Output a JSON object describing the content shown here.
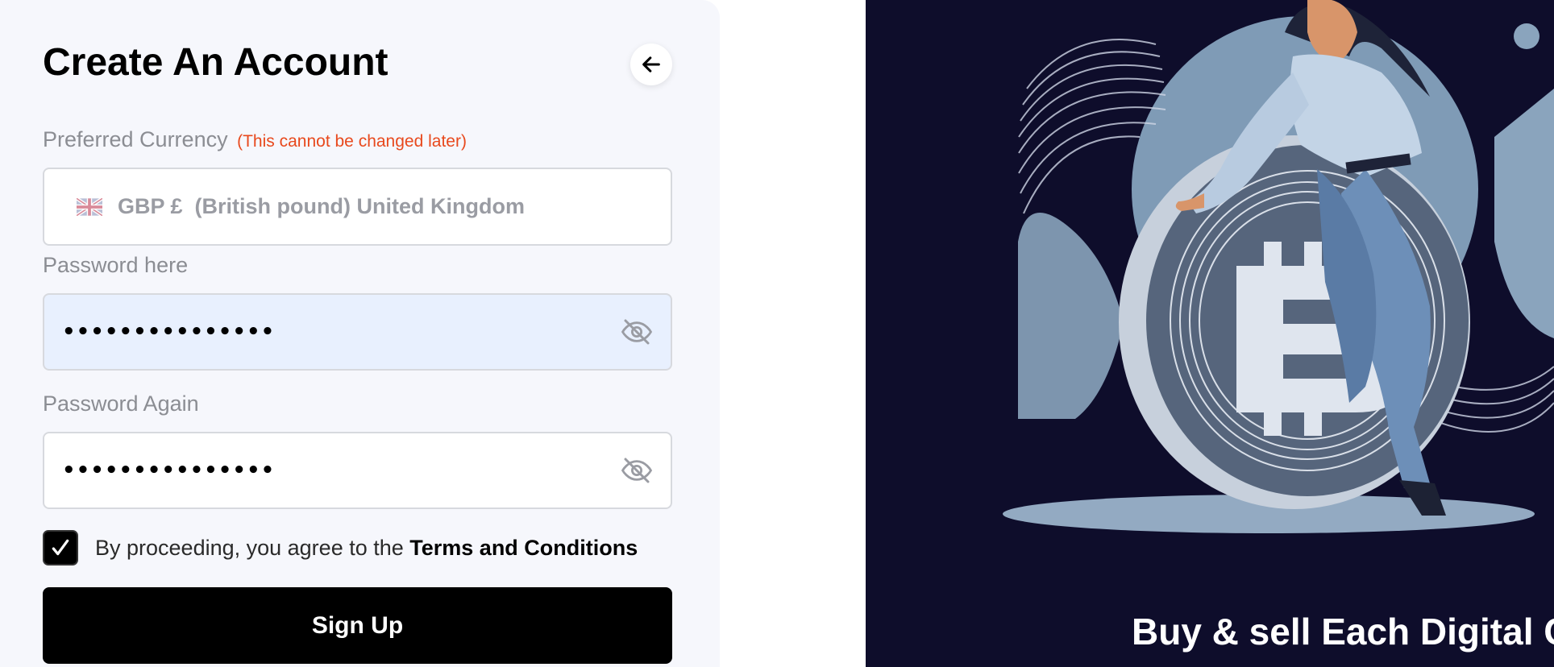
{
  "form": {
    "title": "Create An Account",
    "currency_label": "Preferred Currency",
    "currency_note": "(This cannot be changed later)",
    "currency_value": "GBP £  (British pound) United Kingdom",
    "password_label": "Password here",
    "password_value": "aaaaaaaaaaaaaaa",
    "password_again_label": "Password Again",
    "password_again_value": "aaaaaaaaaaaaaaa",
    "terms_prefix": "By proceeding, you agree to the ",
    "terms_link": "Terms and Conditions",
    "terms_checked": true,
    "signup_label": "Sign Up"
  },
  "hero": {
    "heading": "Buy & sell Each Digital Crypto"
  },
  "icons": {
    "back": "arrow-left-icon",
    "flag": "uk-flag-icon",
    "password_toggle": "eye-slash-icon",
    "checkbox": "checkmark-icon"
  },
  "colors": {
    "warning": "#e8491d",
    "hero_background": "#0e0d2b",
    "primary_button": "#000000",
    "autofill_background": "#e8f0fe"
  }
}
